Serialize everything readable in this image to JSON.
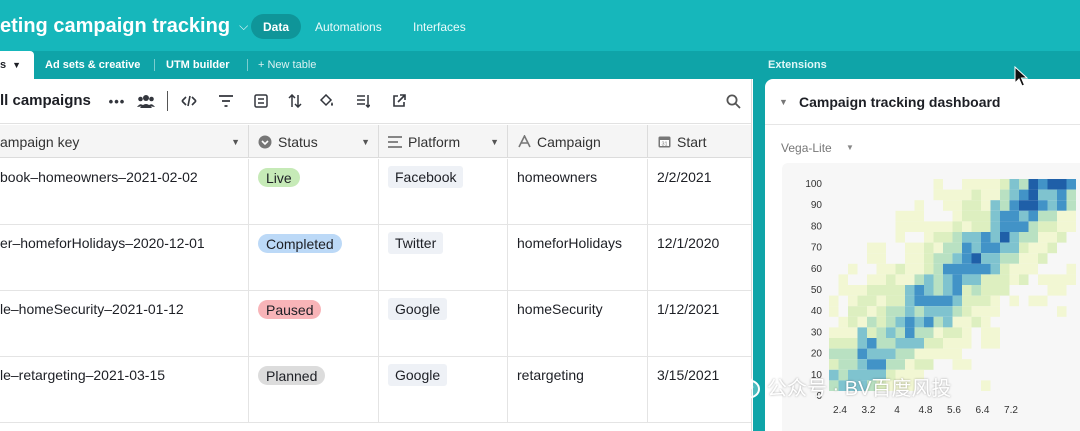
{
  "header": {
    "base_title": "eting campaign tracking",
    "nav": [
      {
        "label": "Data",
        "active": true
      },
      {
        "label": "Automations",
        "active": false
      },
      {
        "label": "Interfaces",
        "active": false
      }
    ]
  },
  "tables_bar": {
    "current_fragment": "s",
    "tabs": [
      "Ad sets & creative",
      "UTM builder"
    ],
    "new_table": "+ New table",
    "extensions_label": "Extensions"
  },
  "view": {
    "name": "ll campaigns"
  },
  "grid": {
    "columns": [
      {
        "label": "ampaign key",
        "icon": "none"
      },
      {
        "label": "Status",
        "icon": "single-select-icon"
      },
      {
        "label": "Platform",
        "icon": "multiline-text-icon"
      },
      {
        "label": "Campaign",
        "icon": "text-field-icon"
      },
      {
        "label": "Start",
        "icon": "calendar-icon"
      }
    ],
    "rows": [
      {
        "key": "book–homeowners–2021-02-02",
        "status": "Live",
        "platform": "Facebook",
        "campaign": "homeowners",
        "start": "2/2/2021"
      },
      {
        "key": "er–homeforHolidays–2020-12-01",
        "status": "Completed",
        "platform": "Twitter",
        "campaign": "homeforHolidays",
        "start": "12/1/2020"
      },
      {
        "key": "le–homeSecurity–2021-01-12",
        "status": "Paused",
        "platform": "Google",
        "campaign": "homeSecurity",
        "start": "1/12/2021"
      },
      {
        "key": "le–retargeting–2021-03-15",
        "status": "Planned",
        "platform": "Google",
        "campaign": "retargeting",
        "start": "3/15/2021"
      }
    ],
    "status_colors": {
      "Live": "#c6eab7",
      "Completed": "#bcd9f7",
      "Paused": "#f8b4b8",
      "Planned": "#dcdcdc"
    }
  },
  "extension": {
    "title": "Campaign tracking dashboard",
    "block_type": "Vega-Lite"
  },
  "chart_data": {
    "type": "heatmap",
    "y_ticks": [
      "100",
      "90",
      "80",
      "70",
      "60",
      "50",
      "40",
      "30",
      "20",
      "10",
      "0"
    ],
    "x_ticks": [
      "2.4",
      "3.2",
      "4",
      "4.8",
      "5.6",
      "6.4",
      "7.2"
    ],
    "ylim": [
      0,
      100
    ],
    "xlim": [
      2.4,
      7.2
    ],
    "color_scheme": [
      "#f2f7d3",
      "#ddefc0",
      "#b9e1c2",
      "#7fc3cf",
      "#4293c7",
      "#1f5fa8"
    ]
  },
  "watermark": {
    "text": "公众号 · BV百度风投"
  }
}
